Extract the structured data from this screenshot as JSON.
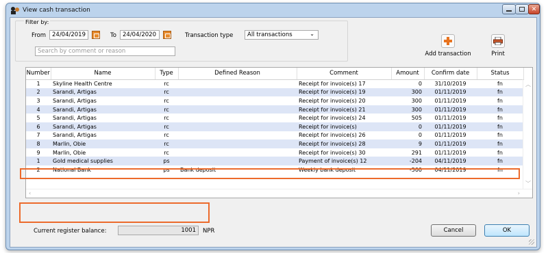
{
  "window": {
    "title": "View cash transaction"
  },
  "filter": {
    "label": "Filter by:",
    "from_label": "From",
    "from_value": "24/04/2019",
    "to_label": "To",
    "to_value": "24/04/2020",
    "type_label": "Transaction type",
    "type_value": "All transactions",
    "search_placeholder": "Search by comment or reason"
  },
  "toolbar": {
    "add_label": "Add transaction",
    "print_label": "Print"
  },
  "table": {
    "headers": [
      "Number",
      "Name",
      "Type",
      "Defined Reason",
      "Comment",
      "Amount",
      "Confirm date",
      "Status"
    ],
    "rows": [
      [
        "1",
        "Skyline Health Centre",
        "rc",
        "",
        "Receipt for invoice(s) 17",
        "0",
        "31/10/2019",
        "fn"
      ],
      [
        "2",
        "Sarandi, Artigas",
        "rc",
        "",
        "Receipt for invoice(s) 19",
        "300",
        "01/11/2019",
        "fn"
      ],
      [
        "3",
        "Sarandi, Artigas",
        "rc",
        "",
        "Receipt for invoice(s) 20",
        "300",
        "01/11/2019",
        "fn"
      ],
      [
        "4",
        "Sarandi, Artigas",
        "rc",
        "",
        "Receipt for invoice(s) 21",
        "300",
        "01/11/2019",
        "fn"
      ],
      [
        "5",
        "Sarandi, Artigas",
        "rc",
        "",
        "Receipt for invoice(s) 24",
        "505",
        "01/11/2019",
        "fn"
      ],
      [
        "6",
        "Sarandi, Artigas",
        "rc",
        "",
        "Receipt for invoice(s)",
        "0",
        "01/11/2019",
        "fn"
      ],
      [
        "7",
        "Sarandi, Artigas",
        "rc",
        "",
        "Receipt for invoice(s) 26",
        "0",
        "01/11/2019",
        "fn"
      ],
      [
        "8",
        "Marlin, Obie",
        "rc",
        "",
        "Receipt for invoice(s) 28",
        "9",
        "01/11/2019",
        "fn"
      ],
      [
        "9",
        "Marlin, Obie",
        "rc",
        "",
        "Receipt for invoice(s) 30",
        "291",
        "01/11/2019",
        "fn"
      ],
      [
        "1",
        "Gold medical supplies",
        "ps",
        "",
        "Payment of invoice(s) 12",
        "-204",
        "04/11/2019",
        "fn"
      ],
      [
        "2",
        "National Bank",
        "ps",
        "Bank deposit",
        "Weekly bank deposit",
        "-500",
        "04/11/2019",
        "fn"
      ]
    ]
  },
  "balance": {
    "label": "Current register balance:",
    "value": "1001",
    "unit": "NPR"
  },
  "buttons": {
    "cancel": "Cancel",
    "ok": "OK"
  },
  "colors": {
    "highlight": "#ec6a2b",
    "alt_row": "#dde5f6",
    "frame": "#bcd3ec"
  }
}
